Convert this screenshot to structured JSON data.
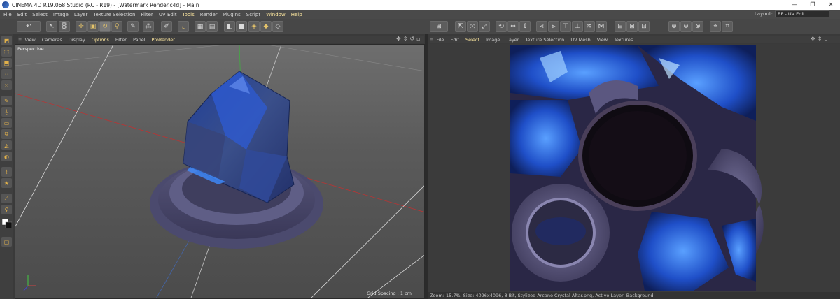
{
  "window": {
    "title": "CINEMA 4D R19.068 Studio (RC - R19) - [Watermark Render.c4d] - Main",
    "controls": [
      "—",
      "❐",
      "✕"
    ]
  },
  "menubar": {
    "items": [
      "File",
      "Edit",
      "Select",
      "Image",
      "Layer",
      "Texture Selection",
      "Filter",
      "UV Edit",
      "Tools",
      "Render",
      "Plugins",
      "Script",
      "Window",
      "Help"
    ],
    "highlighted": [
      "Tools",
      "Window",
      "Help"
    ],
    "layout_label": "Layout:",
    "layout_value": "BP - UV Edit"
  },
  "viewport": {
    "menu": [
      "View",
      "Cameras",
      "Display",
      "Options",
      "Filter",
      "Panel",
      "ProRender"
    ],
    "highlighted": [
      "Options",
      "ProRender"
    ],
    "camera_label": "Perspective",
    "grid_spacing": "Grid Spacing : 1 cm"
  },
  "uv_editor": {
    "menu": [
      "File",
      "Edit",
      "Select",
      "Image",
      "Layer",
      "Texture Selection",
      "UV Mesh",
      "View",
      "Textures"
    ],
    "highlighted": [
      "Select"
    ],
    "status": "Zoom: 15.7%, Size: 4096x4096, 8 Bit, Stylized Arcane Crystal Altar.png, Active Layer: Background"
  },
  "colors": {
    "accent": "#ffe9a0",
    "crystal_blue": "#2f5fd0",
    "stone": "#6a6590"
  }
}
